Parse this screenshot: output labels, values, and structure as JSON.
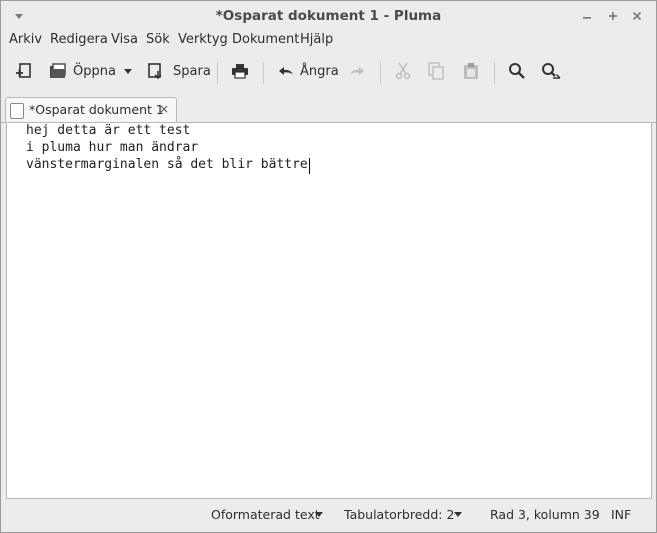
{
  "window": {
    "title": "*Osparat dokument 1 - Pluma",
    "controls": [
      "minimize-icon",
      "maximize-icon",
      "close-icon"
    ]
  },
  "menubar": {
    "items": [
      "Arkiv",
      "Redigera",
      "Visa",
      "Sök",
      "Verktyg",
      "Dokument",
      "Hjälp"
    ]
  },
  "toolbar": {
    "new_icon": "new-document-icon",
    "open_label": "Öppna",
    "save_label": "Spara",
    "undo_label": "Ångra"
  },
  "tabs": [
    {
      "label": "*Osparat dokument 1",
      "close": "×"
    }
  ],
  "editor": {
    "lines": [
      "hej detta är ett test",
      "i pluma hur man ändrar",
      "vänstermarginalen så det blir bättre"
    ]
  },
  "statusbar": {
    "syntax": "Oformaterad text",
    "tab_width": "Tabulatorbredd:  2",
    "position": "Rad 3, kolumn 39",
    "mode": "INF"
  },
  "colors": {
    "window_bg": "#ececec",
    "editor_bg": "#ffffff",
    "text": "#2e2e2e"
  }
}
